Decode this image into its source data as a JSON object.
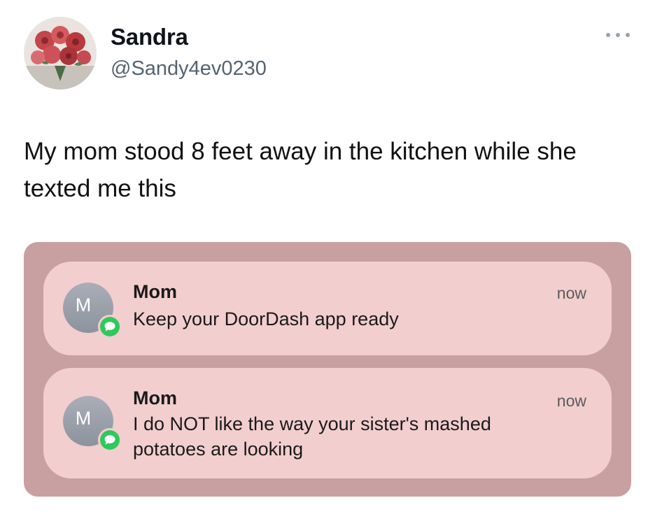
{
  "tweet": {
    "author": {
      "display_name": "Sandra",
      "handle": "@Sandy4ev0230",
      "avatar_icon": "flowers-avatar"
    },
    "more_icon": "more-options-icon",
    "text": "My mom stood 8 feet away in the kitchen while she texted me this"
  },
  "screenshot": {
    "background_color": "#c9a0a2",
    "notification_color": "#f2cecf",
    "notifications": [
      {
        "avatar_letter": "M",
        "app_icon": "messages-icon",
        "sender": "Mom",
        "message": "Keep your DoorDash app ready",
        "time": "now"
      },
      {
        "avatar_letter": "M",
        "app_icon": "messages-icon",
        "sender": "Mom",
        "message": "I do NOT like the way your sister's mashed potatoes are looking",
        "time": "now"
      }
    ]
  }
}
